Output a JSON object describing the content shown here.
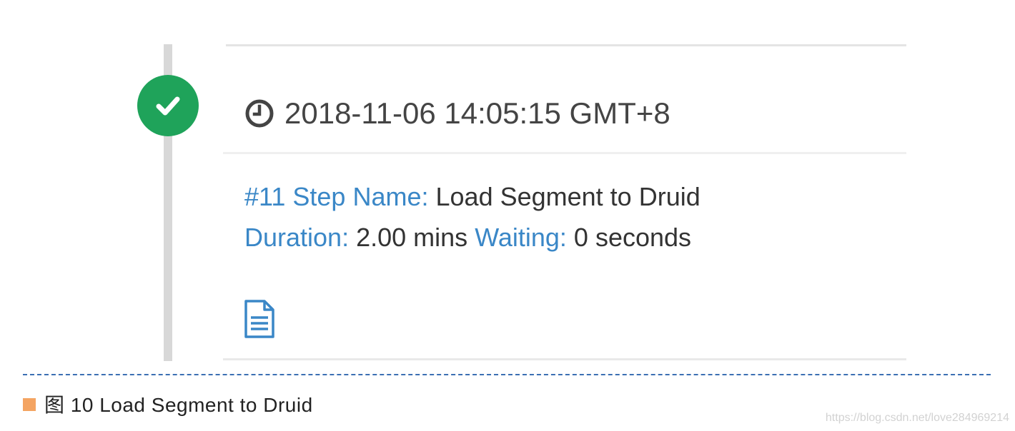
{
  "timeline": {
    "status": "success",
    "status_color": "#1fa35a",
    "status_icon": "check-icon"
  },
  "card": {
    "timestamp": "2018-11-06 14:05:15 GMT+8",
    "clock_icon": "clock-icon",
    "step_name_key": "#11 Step Name:",
    "step_name_value": "Load Segment to Druid",
    "duration_key": "Duration:",
    "duration_value": "2.00 mins",
    "waiting_key": "Waiting:",
    "waiting_value": "0 seconds",
    "log_icon": "document-icon",
    "key_color": "#3a87c7"
  },
  "caption": {
    "text": "图 10 Load Segment to Druid",
    "marker_color": "#f4a462"
  },
  "watermark": {
    "text": "https://blog.csdn.net/love284969214"
  }
}
